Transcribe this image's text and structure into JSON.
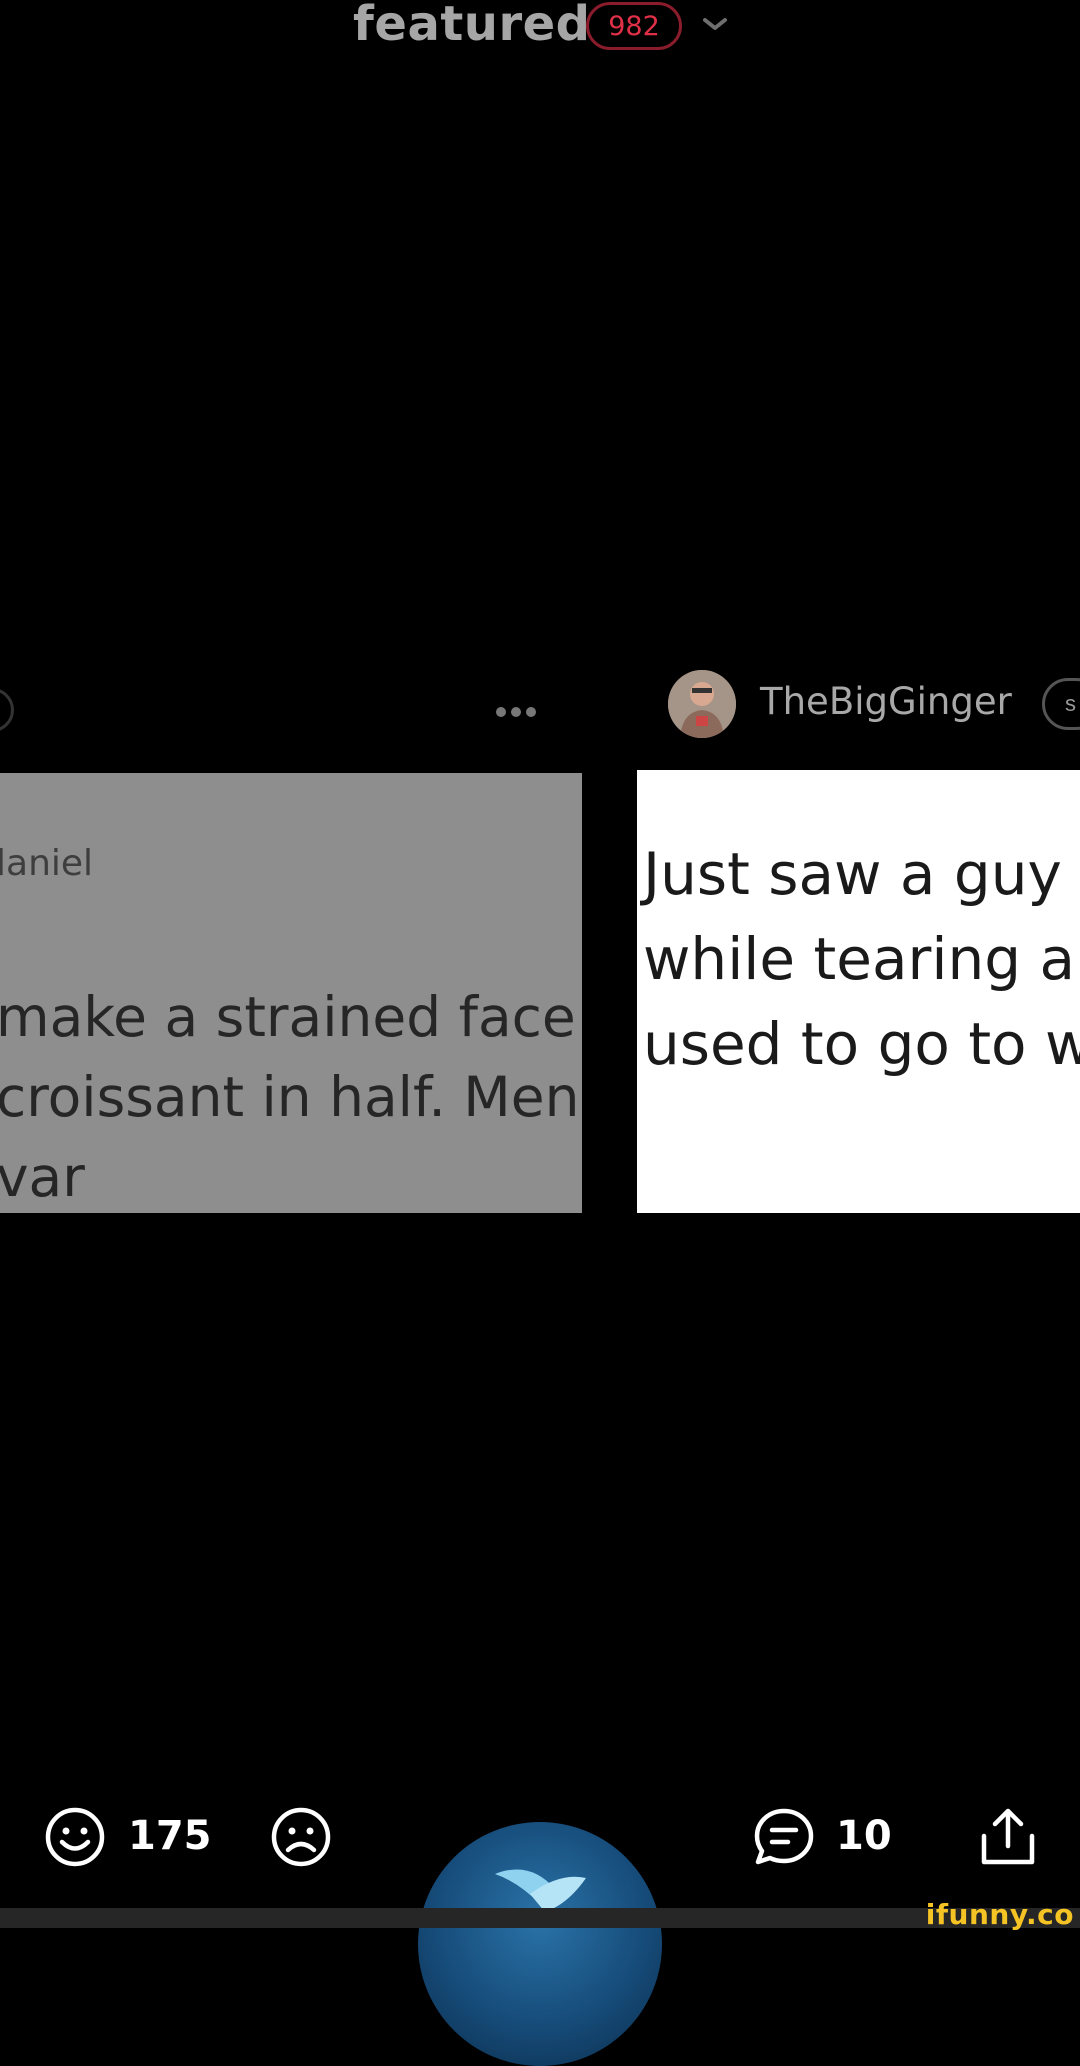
{
  "header": {
    "title": "featured",
    "badge_count": "982"
  },
  "post": {
    "username": "TheBigGinger",
    "subscribe_partial": "s"
  },
  "left_card": {
    "author_partial": "laniel",
    "lines": [
      "make a strained face",
      "croissant in half. Men",
      "var"
    ]
  },
  "right_card": {
    "lines": [
      "Just saw a guy",
      "while tearing a",
      "used to go to w"
    ]
  },
  "actions": {
    "smile_count": "175",
    "comment_count": "10"
  },
  "watermark": "ifunny.co",
  "colors": {
    "badge_border": "#8a1c2c",
    "badge_text": "#e03048",
    "watermark": "#f5c324",
    "fab": "#1a5c8e"
  }
}
